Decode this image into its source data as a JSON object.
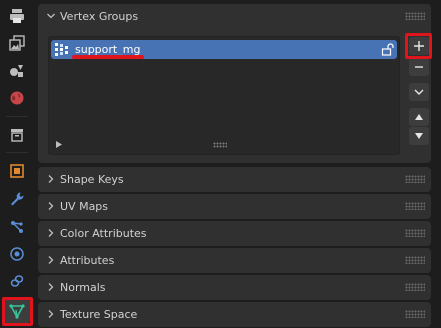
{
  "tabs": [
    {
      "name": "output-tab-icon",
      "icon": "printer-icon"
    },
    {
      "name": "view-layer-tab-icon",
      "icon": "image-stack-icon"
    },
    {
      "name": "scene-tab-icon",
      "icon": "scene-icon"
    },
    {
      "name": "world-tab-icon",
      "icon": "globe-icon"
    },
    {
      "name": "collection-tab-icon",
      "icon": "box-icon"
    },
    {
      "name": "object-tab-icon",
      "icon": "object-square-icon"
    },
    {
      "name": "modifier-tab-icon",
      "icon": "wrench-icon"
    },
    {
      "name": "particles-tab-icon",
      "icon": "particles-icon"
    },
    {
      "name": "physics-tab-icon",
      "icon": "physics-orbit-icon"
    },
    {
      "name": "constraints-tab-icon",
      "icon": "constraint-icon"
    },
    {
      "name": "data-tab-icon",
      "icon": "mesh-triangle-icon"
    }
  ],
  "panels": {
    "vertex_groups": {
      "title": "Vertex Groups",
      "items": [
        {
          "label": "support_mg"
        }
      ]
    },
    "collapsed": [
      {
        "title": "Shape Keys"
      },
      {
        "title": "UV Maps"
      },
      {
        "title": "Color Attributes"
      },
      {
        "title": "Attributes"
      },
      {
        "title": "Normals"
      },
      {
        "title": "Texture Space"
      }
    ]
  },
  "colors": {
    "highlight": "#e0141c",
    "selection": "#4772b3",
    "panel_bg": "#303030",
    "app_bg": "#1d1d1d"
  }
}
